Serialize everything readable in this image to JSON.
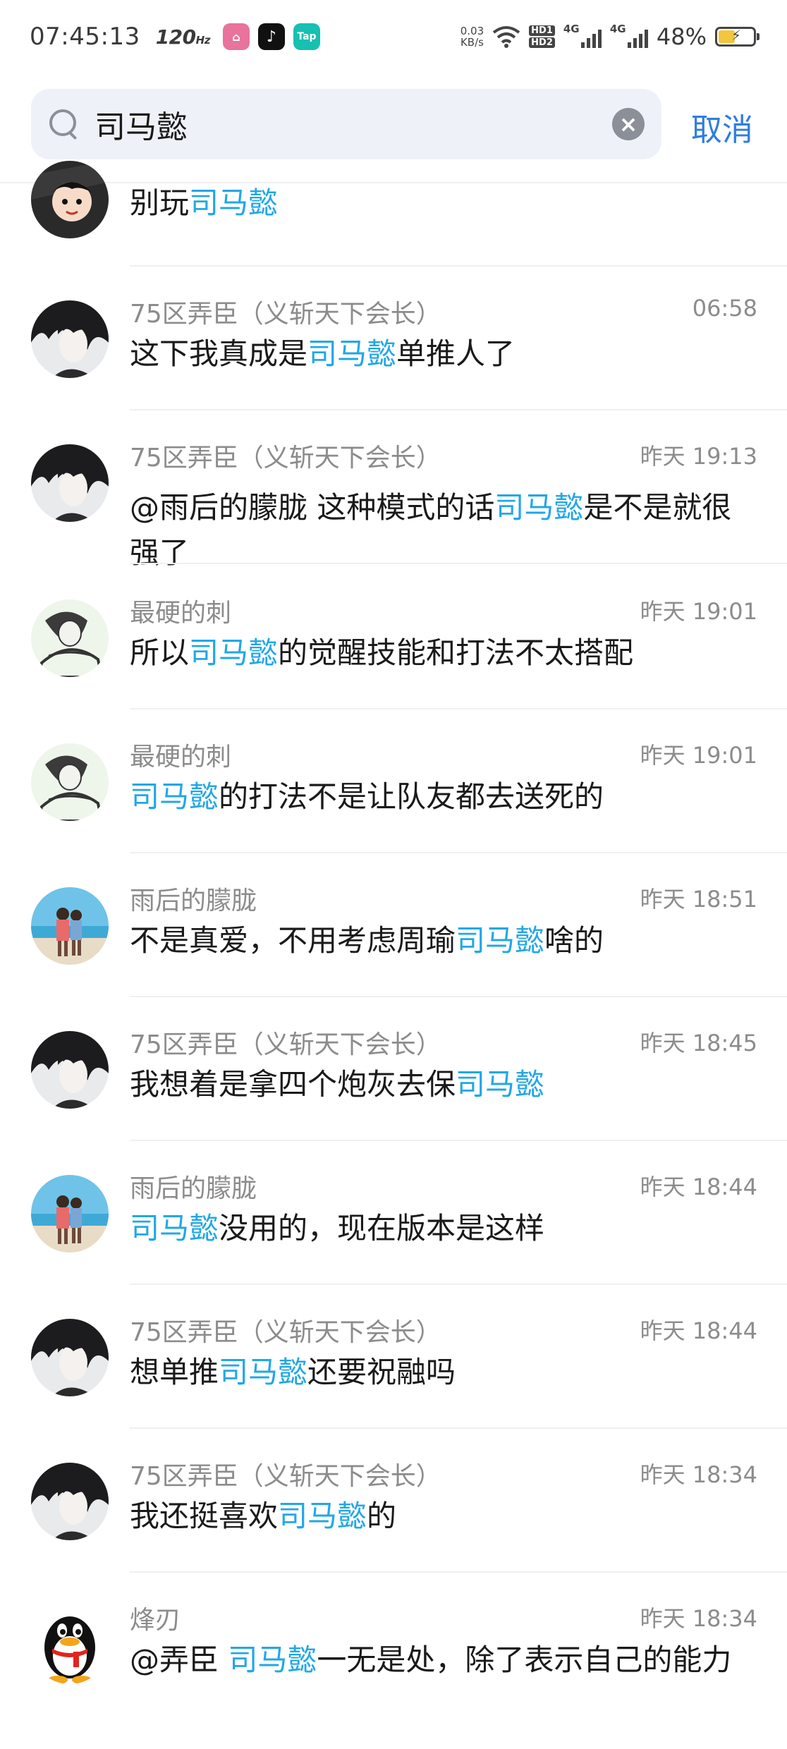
{
  "status_bar": {
    "time": "07:45:13",
    "refresh_rate": "120",
    "refresh_unit": "Hz",
    "net_speed_value": "0.03",
    "net_speed_unit": "KB/s",
    "hd1": "HD1",
    "hd2": "HD2",
    "net1": "4G",
    "net2": "4G",
    "battery_percent": "48%",
    "battery_level": 0.48
  },
  "search": {
    "query": "司马懿",
    "cancel_label": "取消"
  },
  "results": [
    {
      "sender": "",
      "time": "",
      "avatar": "cartoon",
      "segments": [
        {
          "text": "别玩",
          "hl": false
        },
        {
          "text": "司马懿",
          "hl": true
        }
      ]
    },
    {
      "sender": "75区弄臣（义斩天下会长）",
      "time": "06:58",
      "avatar": "dark-hair",
      "segments": [
        {
          "text": "这下我真成是",
          "hl": false
        },
        {
          "text": "司马懿",
          "hl": true
        },
        {
          "text": "单推人了",
          "hl": false
        }
      ]
    },
    {
      "sender": "75区弄臣（义斩天下会长）",
      "time": "昨天 19:13",
      "avatar": "dark-hair",
      "segments": [
        {
          "text": "@雨后的朦胧  这种模式的话",
          "hl": false
        },
        {
          "text": "司马懿",
          "hl": true
        },
        {
          "text": "是不是就很强了",
          "hl": false
        }
      ]
    },
    {
      "sender": "最硬的刺",
      "time": "昨天 19:01",
      "avatar": "sketch",
      "segments": [
        {
          "text": "所以",
          "hl": false
        },
        {
          "text": "司马懿",
          "hl": true
        },
        {
          "text": "的觉醒技能和打法不太搭配",
          "hl": false
        }
      ]
    },
    {
      "sender": "最硬的刺",
      "time": "昨天 19:01",
      "avatar": "sketch",
      "segments": [
        {
          "text": "司马懿",
          "hl": true
        },
        {
          "text": "的打法不是让队友都去送死的",
          "hl": false
        }
      ]
    },
    {
      "sender": "雨后的朦胧",
      "time": "昨天 18:51",
      "avatar": "beach",
      "segments": [
        {
          "text": "不是真爱，不用考虑周瑜",
          "hl": false
        },
        {
          "text": "司马懿",
          "hl": true
        },
        {
          "text": "啥的",
          "hl": false
        }
      ]
    },
    {
      "sender": "75区弄臣（义斩天下会长）",
      "time": "昨天 18:45",
      "avatar": "dark-hair",
      "segments": [
        {
          "text": "我想着是拿四个炮灰去保",
          "hl": false
        },
        {
          "text": "司马懿",
          "hl": true
        }
      ]
    },
    {
      "sender": "雨后的朦胧",
      "time": "昨天 18:44",
      "avatar": "beach",
      "segments": [
        {
          "text": "司马懿",
          "hl": true
        },
        {
          "text": "没用的，现在版本是这样",
          "hl": false
        }
      ]
    },
    {
      "sender": "75区弄臣（义斩天下会长）",
      "time": "昨天 18:44",
      "avatar": "dark-hair",
      "segments": [
        {
          "text": "想单推",
          "hl": false
        },
        {
          "text": "司马懿",
          "hl": true
        },
        {
          "text": "还要祝融吗",
          "hl": false
        }
      ]
    },
    {
      "sender": "75区弄臣（义斩天下会长）",
      "time": "昨天 18:34",
      "avatar": "dark-hair",
      "segments": [
        {
          "text": "我还挺喜欢",
          "hl": false
        },
        {
          "text": "司马懿",
          "hl": true
        },
        {
          "text": "的",
          "hl": false
        }
      ]
    },
    {
      "sender": "烽刃",
      "time": "昨天 18:34",
      "avatar": "penguin",
      "segments": [
        {
          "text": "@弄臣   ",
          "hl": false
        },
        {
          "text": "司马懿",
          "hl": true
        },
        {
          "text": "一无是处，除了表示自己的能力",
          "hl": false
        }
      ]
    }
  ]
}
